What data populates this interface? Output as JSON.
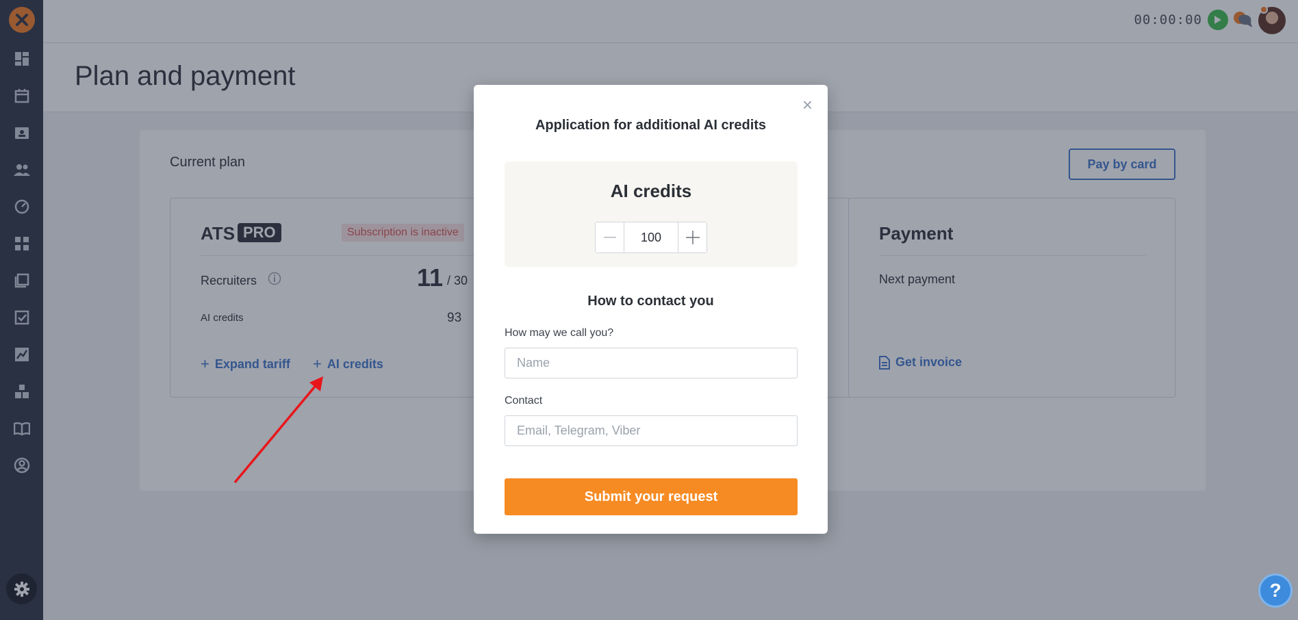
{
  "topbar": {
    "timer": "00:00:00"
  },
  "page": {
    "title": "Plan and payment"
  },
  "plan": {
    "section_label": "Current plan",
    "pay_button": "Pay by card",
    "product": "ATS",
    "tier": "PRO",
    "status": "Subscription is inactive",
    "recruiters_label": "Recruiters",
    "recruiters_value": "11",
    "recruiters_max": "/ 30",
    "ai_credits_label": "AI credits",
    "ai_credits_value": "93",
    "expand_link": "Expand tariff",
    "ai_link": "AI credits"
  },
  "payment": {
    "title": "Payment",
    "next_payment_label": "Next payment",
    "invoice_link": "Get invoice"
  },
  "modal": {
    "close": "×",
    "title": "Application for additional AI credits",
    "credits_heading": "AI credits",
    "credits_value": "100",
    "contact_heading": "How to contact you",
    "name_label": "How may we call you?",
    "name_placeholder": "Name",
    "contact_label": "Contact",
    "contact_placeholder": "Email, Telegram, Viber",
    "submit": "Submit your request"
  },
  "help": {
    "label": "?"
  },
  "colors": {
    "accent": "#3d73c9",
    "brand": "#f47b20",
    "submit": "#f68b24",
    "sidebar": "#2a3140",
    "danger": "#d9534f"
  },
  "icons": {
    "sidebar": [
      "dashboard-icon",
      "calendar-icon",
      "contact-card-icon",
      "people-icon",
      "speedometer-icon",
      "workflow-icon",
      "library-icon",
      "checklist-icon",
      "analytics-icon",
      "integrations-icon",
      "book-icon",
      "profile-icon"
    ]
  }
}
